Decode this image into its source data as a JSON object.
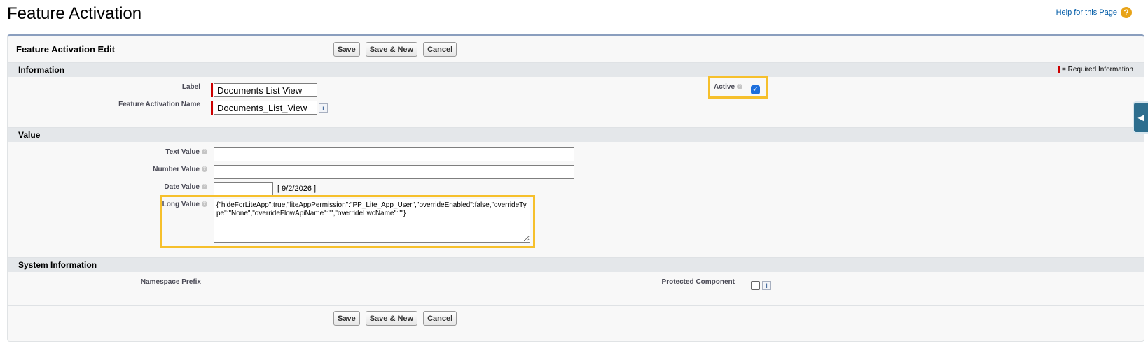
{
  "page": {
    "title": "Feature Activation",
    "help_link": "Help for this Page",
    "help_icon": "?"
  },
  "block": {
    "title": "Feature Activation Edit",
    "buttons": {
      "save": "Save",
      "save_new": "Save & New",
      "cancel": "Cancel"
    }
  },
  "sections": {
    "information": {
      "title": "Information",
      "required_note": "= Required Information",
      "label_label": "Label",
      "label_value": "Documents List View",
      "name_label": "Feature Activation Name",
      "name_value": "Documents_List_View",
      "active_label": "Active",
      "active_checked": true
    },
    "value": {
      "title": "Value",
      "text_label": "Text Value",
      "text_value": "",
      "number_label": "Number Value",
      "number_value": "",
      "date_label": "Date Value",
      "date_value": "",
      "date_link": "9/2/2026",
      "long_label": "Long Value",
      "long_value": "{\"hideForLiteApp\":true,\"liteAppPermission\":\"PP_Lite_App_User\",\"overrideEnabled\":false,\"overrideType\":\"None\",\"overrideFlowApiName\":\"\",\"overrideLwcName\":\"\"}"
    },
    "system": {
      "title": "System Information",
      "namespace_label": "Namespace Prefix",
      "protected_label": "Protected Component",
      "protected_checked": false
    }
  },
  "icons": {
    "info": "i",
    "help_bubble": "?",
    "checkmark": "✓",
    "side_tab_arrow": "◀"
  },
  "colors": {
    "highlight": "#f6c02c",
    "required": "#cc0000",
    "block_border": "#8a9ebe",
    "link": "#015ba7"
  }
}
